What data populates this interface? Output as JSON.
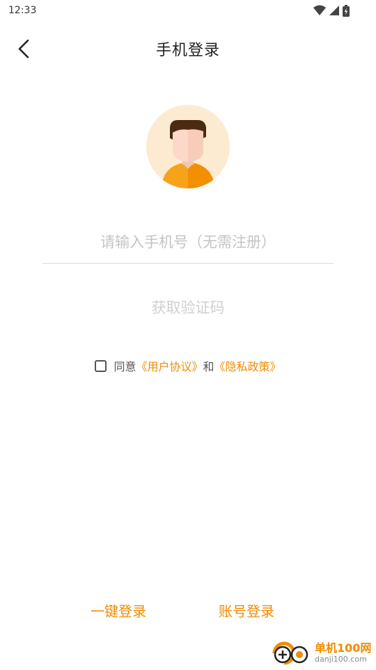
{
  "status_bar": {
    "time": "12:33"
  },
  "header": {
    "title": "手机登录",
    "back_icon": "chevron-left-icon"
  },
  "form": {
    "phone_placeholder": "请输入手机号（无需注册）",
    "phone_value": "",
    "get_code_label": "获取验证码"
  },
  "agreement": {
    "prefix": "同意",
    "user_agreement": "《用户协议》",
    "conjunction": "和",
    "privacy_policy": "《隐私政策》",
    "checked": false
  },
  "bottom": {
    "quick_login": "一键登录",
    "account_login": "账号登录"
  },
  "watermark": {
    "main": "单机100网",
    "sub": "danji100.com"
  },
  "colors": {
    "accent": "#f08c00",
    "avatar_bg": "#fdebd1",
    "disabled_text": "#d0d0d0"
  }
}
